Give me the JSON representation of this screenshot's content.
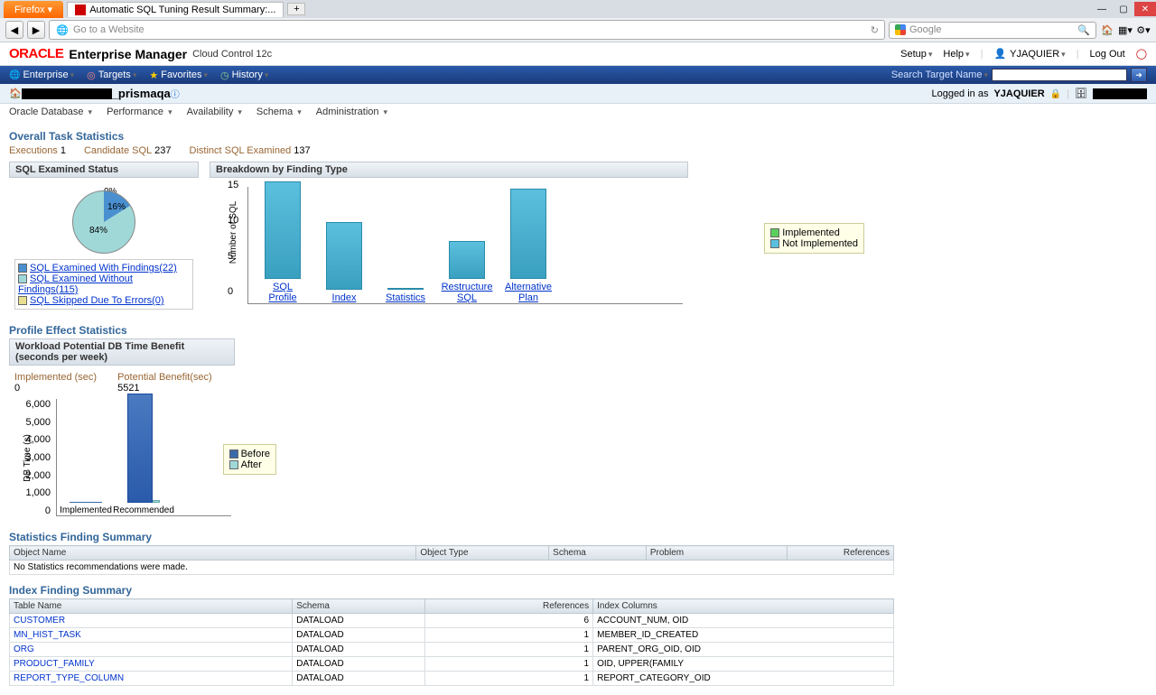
{
  "browser": {
    "firefox_label": "Firefox",
    "tab_title": "Automatic SQL Tuning Result Summary:...",
    "addr_placeholder": "Go to a Website",
    "search_placeholder": "Google"
  },
  "oracle": {
    "logo": "ORACLE",
    "title": "Enterprise Manager",
    "sub": "Cloud Control 12c",
    "setup": "Setup",
    "help": "Help",
    "user": "YJAQUIER",
    "logout": "Log Out"
  },
  "bluenav": {
    "items": [
      "Enterprise",
      "Targets",
      "Favorites",
      "History"
    ],
    "search_label": "Search Target Name"
  },
  "crumb": {
    "name": "_prismaqa",
    "logged_in": "Logged in as",
    "logged_user": "YJAQUIER"
  },
  "submenu": [
    "Oracle Database",
    "Performance",
    "Availability",
    "Schema",
    "Administration"
  ],
  "task_stats": {
    "title": "Overall Task Statistics",
    "exec_label": "Executions",
    "exec_val": "1",
    "cand_label": "Candidate SQL",
    "cand_val": "237",
    "dist_label": "Distinct SQL Examined",
    "dist_val": "137"
  },
  "pie_panel": {
    "title": "SQL Examined Status",
    "label0": "0%",
    "label16": "16%",
    "label84": "84%",
    "legend": [
      "SQL Examined With Findings(22)",
      "SQL Examined Without Findings(115)",
      "SQL Skipped Due To Errors(0)"
    ]
  },
  "bar_panel": {
    "title": "Breakdown by Finding Type",
    "ylabel": "Number of SQL",
    "legend_impl": "Implemented",
    "legend_notimpl": "Not Implemented"
  },
  "chart_data": [
    {
      "type": "pie",
      "title": "SQL Examined Status",
      "categories": [
        "SQL Examined With Findings",
        "SQL Examined Without Findings",
        "SQL Skipped Due To Errors"
      ],
      "values": [
        16,
        84,
        0
      ]
    },
    {
      "type": "bar",
      "title": "Breakdown by Finding Type",
      "ylabel": "Number of SQL",
      "ylim": [
        0,
        15
      ],
      "categories": [
        "SQL Profile",
        "Index",
        "Statistics",
        "Restructure SQL",
        "Alternative Plan"
      ],
      "series": [
        {
          "name": "Implemented",
          "values": [
            0,
            0,
            0,
            0,
            0
          ]
        },
        {
          "name": "Not Implemented",
          "values": [
            13,
            9,
            0,
            5,
            12
          ]
        }
      ]
    },
    {
      "type": "bar",
      "title": "Workload Potential DB Time Benefit (seconds per week)",
      "ylabel": "DB Time (s)",
      "ylim": [
        0,
        6000
      ],
      "categories": [
        "Implemented",
        "Recommended"
      ],
      "series": [
        {
          "name": "Before",
          "values": [
            0,
            5600
          ]
        },
        {
          "name": "After",
          "values": [
            0,
            100
          ]
        }
      ]
    }
  ],
  "profile": {
    "section": "Profile Effect Statistics",
    "title": "Workload Potential DB Time Benefit (seconds per week)",
    "impl_label": "Implemented (sec)",
    "impl_val": "0",
    "pot_label": "Potential Benefit(sec)",
    "pot_val": "5521",
    "ylabel": "DB Time (s)",
    "x": [
      "Implemented",
      "Recommended"
    ],
    "legend_before": "Before",
    "legend_after": "After"
  },
  "stats_finding": {
    "title": "Statistics Finding Summary",
    "cols": [
      "Object Name",
      "Object Type",
      "Schema",
      "Problem",
      "References"
    ],
    "empty": "No Statistics recommendations were made."
  },
  "index_finding": {
    "title": "Index Finding Summary",
    "cols": [
      "Table Name",
      "Schema",
      "References",
      "Index Columns"
    ],
    "rows": [
      {
        "t": "CUSTOMER",
        "s": "DATALOAD",
        "r": "6",
        "c": "ACCOUNT_NUM, OID"
      },
      {
        "t": "MN_HIST_TASK",
        "s": "DATALOAD",
        "r": "1",
        "c": "MEMBER_ID_CREATED"
      },
      {
        "t": "ORG",
        "s": "DATALOAD",
        "r": "1",
        "c": "PARENT_ORG_OID, OID"
      },
      {
        "t": "PRODUCT_FAMILY",
        "s": "DATALOAD",
        "r": "1",
        "c": "OID, UPPER(FAMILY"
      },
      {
        "t": "REPORT_TYPE_COLUMN",
        "s": "DATALOAD",
        "r": "1",
        "c": "REPORT_CATEGORY_OID"
      }
    ]
  }
}
